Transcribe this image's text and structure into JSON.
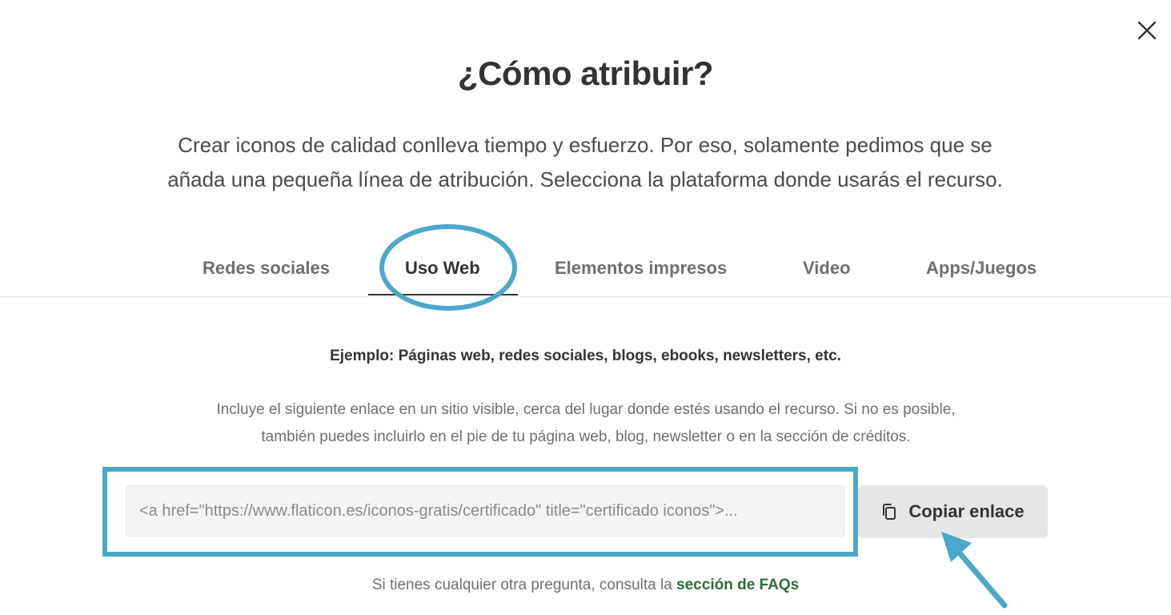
{
  "modal": {
    "title": "¿Cómo atribuir?",
    "intro_line1": "Crear iconos de calidad conlleva tiempo y esfuerzo. Por eso, solamente pedimos que se",
    "intro_line2": "añada una pequeña línea de atribución. Selecciona la plataforma donde usarás el recurso.",
    "close_icon": "close-icon"
  },
  "tabs": [
    {
      "label": "Redes sociales",
      "active": false
    },
    {
      "label": "Uso Web",
      "active": true
    },
    {
      "label": "Elementos impresos",
      "active": false
    },
    {
      "label": "Video",
      "active": false
    },
    {
      "label": "Apps/Juegos",
      "active": false
    }
  ],
  "content": {
    "example": "Ejemplo: Páginas web, redes sociales, blogs, ebooks, newsletters, etc.",
    "instructions_line1": "Incluye el siguiente enlace en un sitio visible, cerca del lugar donde estés usando el recurso. Si no es posible,",
    "instructions_line2": "también puedes incluirlo en el pie de tu página web, blog, newsletter o en la sección de créditos.",
    "link_value": "<a href=\"https://www.flaticon.es/iconos-gratis/certificado\" title=\"certificado iconos\">...",
    "copy_label": "Copiar enlace",
    "copy_icon": "copy-icon"
  },
  "footer": {
    "faq_prefix": "Si tienes cualquier otra pregunta, consulta la",
    "faq_link": "sección de FAQs"
  },
  "colors": {
    "highlight": "#4aa8c8",
    "faq_link": "#2f6b38",
    "copy_button_bg": "#e6e6e6"
  }
}
